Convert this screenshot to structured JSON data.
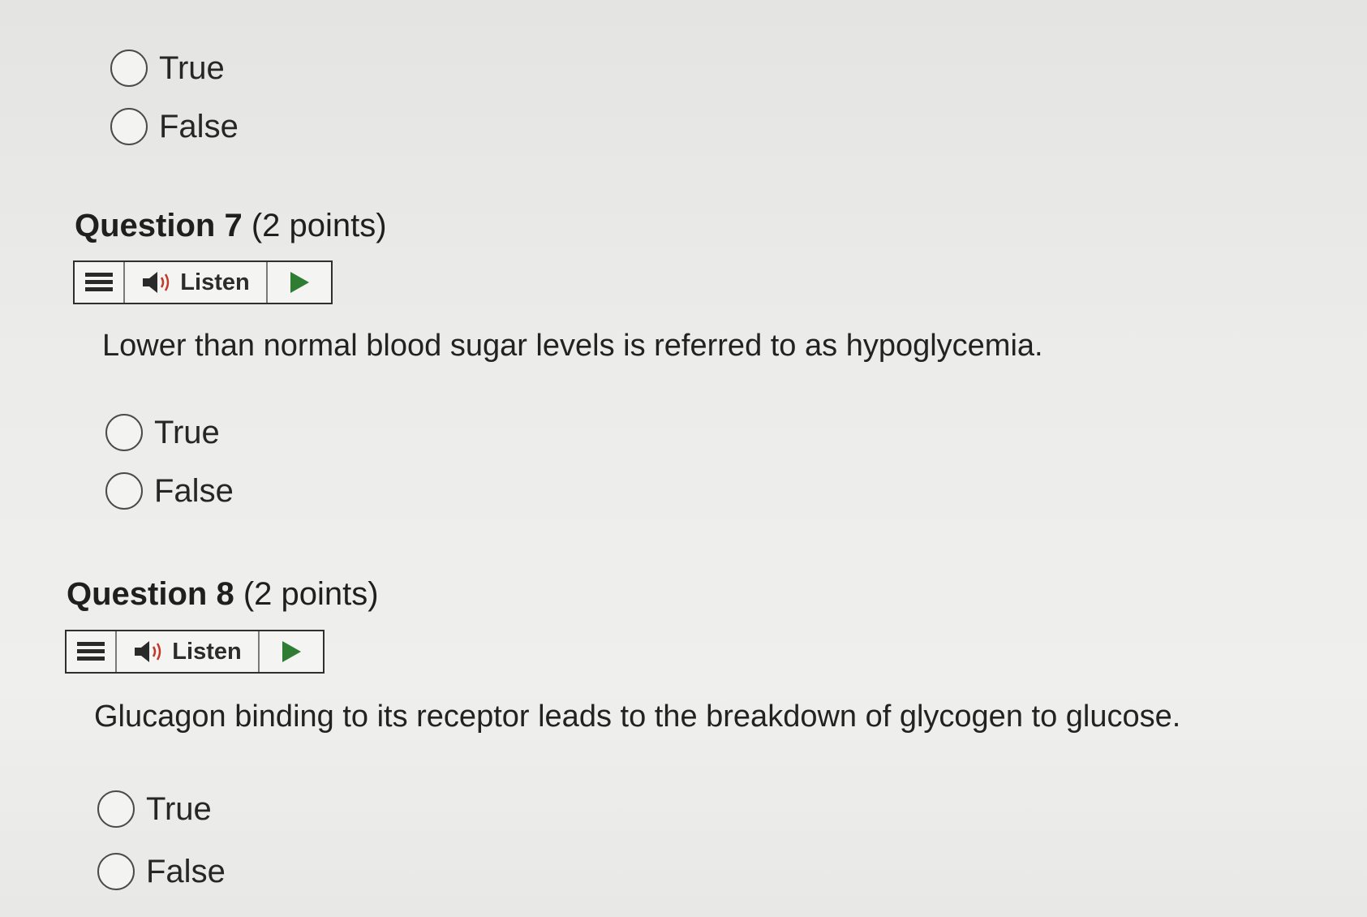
{
  "previous": {
    "options": [
      "True",
      "False"
    ]
  },
  "questions": [
    {
      "title": "Question 7",
      "points": "(2 points)",
      "listen_label": "Listen",
      "text": "Lower than normal blood sugar levels is referred to as hypoglycemia.",
      "options": [
        "True",
        "False"
      ]
    },
    {
      "title": "Question 8",
      "points": "(2 points)",
      "listen_label": "Listen",
      "text": "Glucagon binding to its receptor leads to the breakdown of glycogen to glucose.",
      "options": [
        "True",
        "False"
      ]
    }
  ],
  "icons": {
    "menu": "menu-icon",
    "speaker": "speaker-icon",
    "play": "play-icon"
  },
  "colors": {
    "play_green": "#2e7d32"
  }
}
